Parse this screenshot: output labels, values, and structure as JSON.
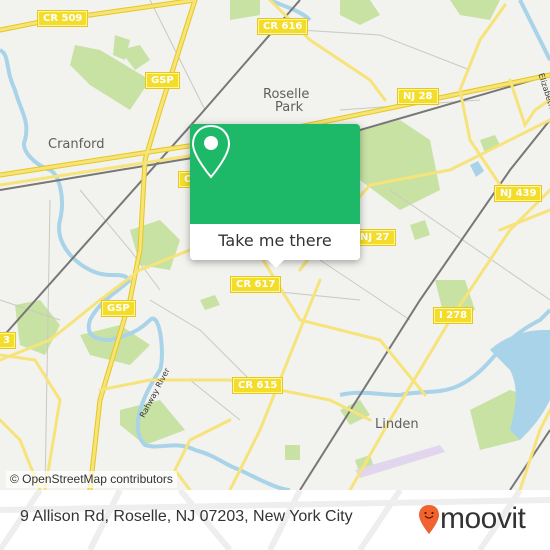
{
  "map": {
    "attribution": "© OpenStreetMap contributors",
    "colors": {
      "background": "#f2f2ee",
      "water": "#a9d3e8",
      "park": "#c8e2a4",
      "road_major": "#f6e37a",
      "road_minor": "#c9c9c3",
      "rail": "#777777"
    },
    "places": [
      {
        "name": "Cranford"
      },
      {
        "name": "Roselle"
      },
      {
        "name": "Park"
      },
      {
        "name": "Linden"
      }
    ],
    "road_shields": [
      {
        "label": "CR 509"
      },
      {
        "label": "CR 616"
      },
      {
        "label": "GSP"
      },
      {
        "label": "NJ 28"
      },
      {
        "label": "NJ 439"
      },
      {
        "label": "NJ 27"
      },
      {
        "label": "CR 617"
      },
      {
        "label": "GSP"
      },
      {
        "label": "I 278"
      },
      {
        "label": "CR 615"
      },
      {
        "label": "3"
      },
      {
        "label": "C"
      }
    ],
    "water_labels": [
      {
        "name": "Rahway River"
      }
    ],
    "street_labels": [
      {
        "name": "Elizabeth Av"
      }
    ]
  },
  "popup": {
    "icon": "location-pin-icon",
    "button_label": "Take me there",
    "color": "#1db868"
  },
  "footer": {
    "address": "9 Allison Rd, Roselle, NJ 07203, New York City",
    "logo_text": "moovit",
    "logo_color": "#f0622e"
  }
}
